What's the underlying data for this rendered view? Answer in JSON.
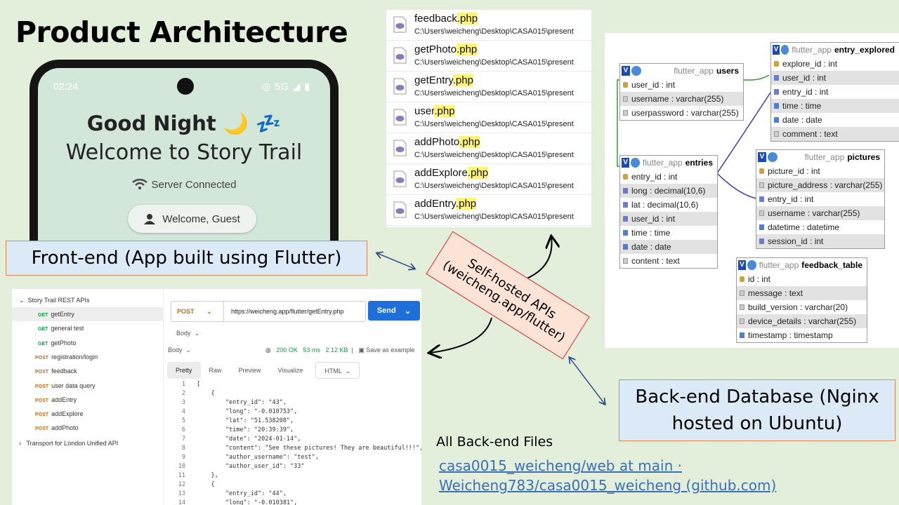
{
  "title": "Product Architecture",
  "phone": {
    "status_time": "02:24",
    "status_right": "5G",
    "greeting": "Good Night 🌙 💤",
    "welcome_title": "Welcome to Story Trail",
    "server_status": "Server Connected",
    "guest_label": "Welcome, Guest"
  },
  "frontend_label": "Front-end (App built using Flutter)",
  "backend_label_line1": "Back-end Database (Nginx",
  "backend_label_line2": "hosted on Ubuntu)",
  "apis_label_line1": "Self-hosted APIs",
  "apis_label_line2": "(weicheng.app/flutter)",
  "files": [
    {
      "name": "feedback",
      "ext": ".php",
      "path": "C:\\Users\\weicheng\\Desktop\\CASA015\\present"
    },
    {
      "name": "getPhoto",
      "ext": ".php",
      "path": "C:\\Users\\weicheng\\Desktop\\CASA015\\present"
    },
    {
      "name": "getEntry",
      "ext": ".php",
      "path": "C:\\Users\\weicheng\\Desktop\\CASA015\\present"
    },
    {
      "name": "user",
      "ext": ".php",
      "path": "C:\\Users\\weicheng\\Desktop\\CASA015\\present"
    },
    {
      "name": "addPhoto",
      "ext": ".php",
      "path": "C:\\Users\\weicheng\\Desktop\\CASA015\\present"
    },
    {
      "name": "addExplore",
      "ext": ".php",
      "path": "C:\\Users\\weicheng\\Desktop\\CASA015\\present"
    },
    {
      "name": "addEntry",
      "ext": ".php",
      "path": "C:\\Users\\weicheng\\Desktop\\CASA015\\present"
    }
  ],
  "db": {
    "schema": "flutter_app",
    "users": {
      "name": "users",
      "cols": [
        "user_id : int",
        "username : varchar(255)",
        "userpassword : varchar(255)"
      ]
    },
    "entries": {
      "name": "entries",
      "cols": [
        "entry_id : int",
        "long : decimal(10,6)",
        "lat : decimal(10,6)",
        "user_id : int",
        "time : time",
        "date : date",
        "content : text"
      ]
    },
    "entry_explored": {
      "name": "entry_explored",
      "cols": [
        "explore_id : int",
        "user_id : int",
        "entry_id : int",
        "time : time",
        "date : date",
        "comment : text"
      ]
    },
    "pictures": {
      "name": "pictures",
      "cols": [
        "picture_id : int",
        "picture_address : varchar(255)",
        "entry_id : int",
        "username : varchar(255)",
        "datetime : datetime",
        "session_id : int"
      ]
    },
    "feedback_table": {
      "name": "feedback_table",
      "cols": [
        "id : int",
        "message : text",
        "build_version : varchar(20)",
        "device_details : varchar(255)",
        "timestamp : timestamp"
      ]
    }
  },
  "api": {
    "collection": "Story Trail REST APIs",
    "items": [
      {
        "method": "GET",
        "label": "getEntry"
      },
      {
        "method": "GET",
        "label": "general test"
      },
      {
        "method": "GET",
        "label": "getPhoto"
      },
      {
        "method": "POST",
        "label": "registration/login"
      },
      {
        "method": "POST",
        "label": "feedback"
      },
      {
        "method": "POST",
        "label": "user data query"
      },
      {
        "method": "POST",
        "label": "addEntry"
      },
      {
        "method": "POST",
        "label": "addExplore"
      },
      {
        "method": "POST",
        "label": "addPhoto"
      }
    ],
    "other_collection": "Transport for London Unified API",
    "method": "POST",
    "url": "https://weicheng.app/flutter/getEntry.php",
    "send": "Send",
    "body_label": "Body",
    "status": "200 OK",
    "time": "53 ms",
    "size": "2.12 KB",
    "save": "Save as example",
    "tabs": [
      "Pretty",
      "Raw",
      "Preview",
      "Visualize"
    ],
    "format": "HTML",
    "code": [
      "[",
      "    {",
      "        \"entry_id\": \"43\",",
      "        \"long\": \"-0.010753\",",
      "        \"lat\": \"51.538208\",",
      "        \"time\": \"20:39:39\",",
      "        \"date\": \"2024-01-14\",",
      "        \"content\": \"See these pictures! They are beautiful!!!\",",
      "        \"author_username\": \"test\",",
      "        \"author_user_id\": \"33\"",
      "    },",
      "    {",
      "        \"entry_id\": \"44\",",
      "        \"long\": \"-0.010381\","
    ]
  },
  "all_files_label": "All Back-end Files",
  "github_link": "casa0015_weicheng/web at main · Weicheng783/casa0015_weicheng (github.com)"
}
